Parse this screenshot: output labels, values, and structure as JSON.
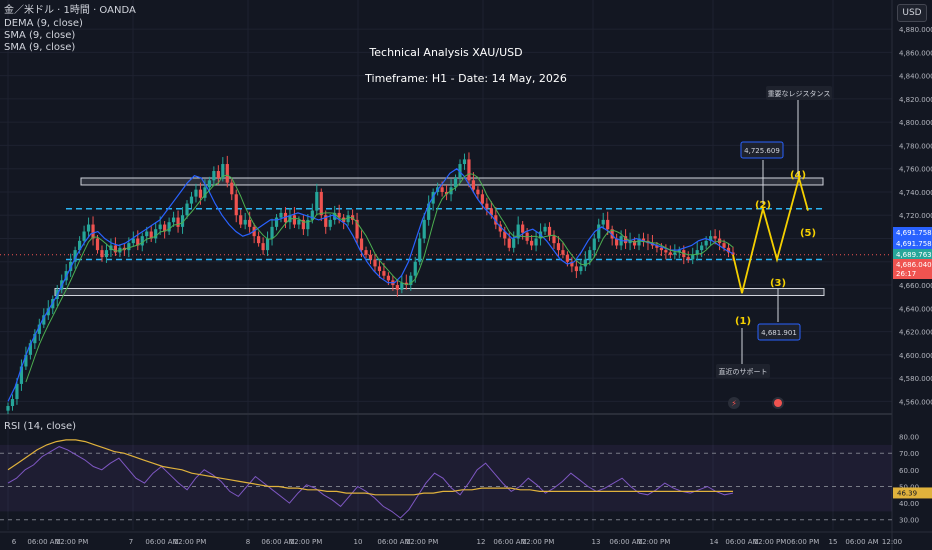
{
  "header": {
    "symbol_line": "金／米ドル · 1時間 · OANDA",
    "indicators": [
      "DEMA (9, close)",
      "SMA (9, close)",
      "SMA (9, close)"
    ],
    "currency_button": "USD"
  },
  "annotation": {
    "title": "Technical Analysis XAU/USD",
    "subtitle": "Timeframe: H1 - Date: 14 May, 2026",
    "resistance_label": "重要なレジスタンス",
    "support_label": "直近のサポート",
    "wave_labels": [
      "(1)",
      "(2)",
      "(3)",
      "(4)",
      "(5)"
    ],
    "target_high": "4,725.609",
    "target_low": "4,681.901"
  },
  "price_badges": [
    {
      "text": "4,691.758",
      "color": "#2962ff"
    },
    {
      "text": "4,691.758",
      "color": "#2962ff"
    },
    {
      "text": "4,689.763",
      "color": "#26a69a"
    },
    {
      "text": "4,686.040",
      "color": "#ef5350"
    },
    {
      "text": "26:17",
      "color": "#ef5350"
    }
  ],
  "rsi": {
    "label": "RSI (14, close)",
    "current": "46.39",
    "overbought": 70,
    "oversold": 30
  },
  "colors": {
    "background": "#131722",
    "up_candle": "#26a69a",
    "down_candle": "#ef5350",
    "dema": "#2962ff",
    "sma": "#4caf50",
    "projection": "#f5d000",
    "level_line": "#29b6f6",
    "rsi_line": "#7e57c2",
    "rsi_ma": "#e0b23c"
  },
  "chart_data": {
    "type": "candlestick",
    "title": "Technical Analysis XAU/USD",
    "subtitle": "Timeframe: H1 - Date: 14 May, 2026",
    "timeframe": "H1",
    "y_axis": {
      "ylim": [
        4550,
        4905
      ],
      "ticks": [
        4560,
        4580,
        4600,
        4620,
        4640,
        4660,
        4680,
        4700,
        4720,
        4740,
        4760,
        4780,
        4800,
        4820,
        4840,
        4860,
        4880
      ],
      "tick_labels": [
        "4,560.000",
        "4,580.000",
        "4,600.000",
        "4,620.000",
        "4,640.000",
        "4,660.000",
        "4,680.000",
        "4,700.000",
        "4,720.000",
        "4,740.000",
        "4,760.000",
        "4,780.000",
        "4,800.000",
        "4,820.000",
        "4,840.000",
        "4,860.000",
        "4,880.000"
      ]
    },
    "x_axis": {
      "tick_labels": [
        "6",
        "06:00 AM",
        "12:00 PM",
        "7",
        "06:00 AM",
        "12:00 PM",
        "8",
        "06:00 AM",
        "12:00 PM",
        "10",
        "06:00 AM",
        "12:00 PM",
        "12",
        "06:00 AM",
        "12:00 PM",
        "13",
        "06:00 AM",
        "12:00 PM",
        "14",
        "06:00 AM",
        "12:00 PM",
        "06:00 PM",
        "15",
        "06:00 AM",
        "12:00"
      ],
      "day_labels": [
        "6",
        "7",
        "8",
        "10",
        "12",
        "13",
        "14",
        "15"
      ]
    },
    "candles_close": [
      4556,
      4562,
      4575,
      4590,
      4600,
      4610,
      4618,
      4626,
      4634,
      4640,
      4648,
      4656,
      4664,
      4672,
      4680,
      4690,
      4698,
      4706,
      4712,
      4700,
      4690,
      4684,
      4690,
      4694,
      4688,
      4692,
      4690,
      4696,
      4700,
      4694,
      4702,
      4706,
      4700,
      4708,
      4712,
      4706,
      4714,
      4718,
      4710,
      4720,
      4730,
      4736,
      4742,
      4735,
      4744,
      4750,
      4758,
      4752,
      4764,
      4748,
      4738,
      4720,
      4712,
      4716,
      4710,
      4702,
      4696,
      4690,
      4700,
      4710,
      4718,
      4722,
      4714,
      4720,
      4712,
      4716,
      4708,
      4716,
      4724,
      4740,
      4720,
      4710,
      4716,
      4722,
      4718,
      4714,
      4720,
      4716,
      4700,
      4690,
      4686,
      4682,
      4676,
      4672,
      4668,
      4664,
      4660,
      4656,
      4662,
      4660,
      4668,
      4680,
      4700,
      4716,
      4730,
      4740,
      4744,
      4740,
      4738,
      4744,
      4752,
      4764,
      4768,
      4750,
      4742,
      4738,
      4730,
      4726,
      4720,
      4712,
      4706,
      4700,
      4692,
      4700,
      4712,
      4705,
      4698,
      4694,
      4700,
      4706,
      4710,
      4702,
      4696,
      4690,
      4686,
      4680,
      4676,
      4672,
      4676,
      4682,
      4690,
      4700,
      4712,
      4716,
      4708,
      4700,
      4694,
      4702,
      4696,
      4698,
      4694,
      4700,
      4698,
      4696,
      4694,
      4692,
      4690,
      4688,
      4686,
      4688,
      4690,
      4684,
      4682,
      4686,
      4690,
      4694,
      4698,
      4702,
      4700,
      4696,
      4692,
      4688,
      4686
    ],
    "dema": [
      4560,
      4572,
      4590,
      4606,
      4618,
      4630,
      4640,
      4650,
      4662,
      4674,
      4686,
      4696,
      4704,
      4706,
      4700,
      4696,
      4694,
      4696,
      4700,
      4704,
      4708,
      4712,
      4716,
      4724,
      4732,
      4740,
      4748,
      4754,
      4752,
      4742,
      4730,
      4720,
      4712,
      4706,
      4702,
      4704,
      4708,
      4712,
      4716,
      4716,
      4718,
      4720,
      4722,
      4720,
      4718,
      4716,
      4718,
      4720,
      4716,
      4712,
      4702,
      4690,
      4680,
      4672,
      4666,
      4662,
      4662,
      4668,
      4680,
      4698,
      4716,
      4730,
      4740,
      4748,
      4756,
      4760,
      4754,
      4744,
      4734,
      4726,
      4720,
      4712,
      4706,
      4700,
      4702,
      4706,
      4708,
      4704,
      4698,
      4690,
      4682,
      4678,
      4680,
      4688,
      4698,
      4706,
      4710,
      4706,
      4700,
      4698,
      4698,
      4700,
      4698,
      4696,
      4694,
      4692,
      4690,
      4690,
      4692,
      4694,
      4698,
      4700,
      4698,
      4694,
      4690,
      4687
    ],
    "resistance_zone": [
      4746,
      4752
    ],
    "support_zone": [
      4651,
      4657
    ],
    "dashed_levels": [
      4725.609,
      4681.901
    ],
    "projection_path": {
      "labels": [
        "(1)",
        "(2)",
        "(3)",
        "(4)",
        "(5)"
      ],
      "prices": [
        4686,
        4653,
        4725.609,
        4681.901,
        4752,
        4724
      ]
    },
    "rsi_series": {
      "name": "RSI (14, close)",
      "ylim": [
        25,
        90
      ],
      "ticks": [
        30,
        40,
        50,
        60,
        70,
        80
      ],
      "tick_labels": [
        "30.00",
        "40.00",
        "50.00",
        "60.00",
        "70.00",
        "80.00"
      ],
      "rsi_values": [
        52,
        55,
        60,
        63,
        68,
        71,
        74,
        72,
        69,
        66,
        62,
        60,
        64,
        67,
        61,
        55,
        52,
        58,
        62,
        57,
        52,
        48,
        55,
        60,
        57,
        53,
        47,
        44,
        50,
        56,
        52,
        48,
        44,
        40,
        46,
        51,
        49,
        45,
        42,
        38,
        44,
        50,
        47,
        43,
        38,
        35,
        31,
        36,
        44,
        52,
        58,
        55,
        49,
        45,
        52,
        60,
        64,
        58,
        52,
        47,
        50,
        55,
        51,
        46,
        49,
        53,
        58,
        54,
        50,
        47,
        49,
        52,
        55,
        50,
        46,
        45,
        48,
        52,
        49,
        47,
        46,
        48,
        50,
        47,
        45,
        46
      ],
      "ma_values": [
        60,
        64,
        68,
        72,
        75,
        77,
        78,
        78,
        77,
        75,
        73,
        71,
        70,
        68,
        66,
        64,
        62,
        61,
        60,
        58,
        57,
        56,
        55,
        54,
        53,
        52,
        51,
        50,
        50,
        49,
        49,
        48,
        48,
        47,
        47,
        46,
        46,
        46,
        45,
        45,
        45,
        45,
        45,
        46,
        46,
        47,
        47,
        48,
        48,
        49,
        49,
        49,
        49,
        48,
        48,
        47,
        47,
        47,
        47,
        47,
        47,
        47,
        47,
        47,
        47,
        47,
        47,
        47,
        47,
        47,
        47,
        47,
        47,
        47,
        47,
        47
      ]
    }
  }
}
